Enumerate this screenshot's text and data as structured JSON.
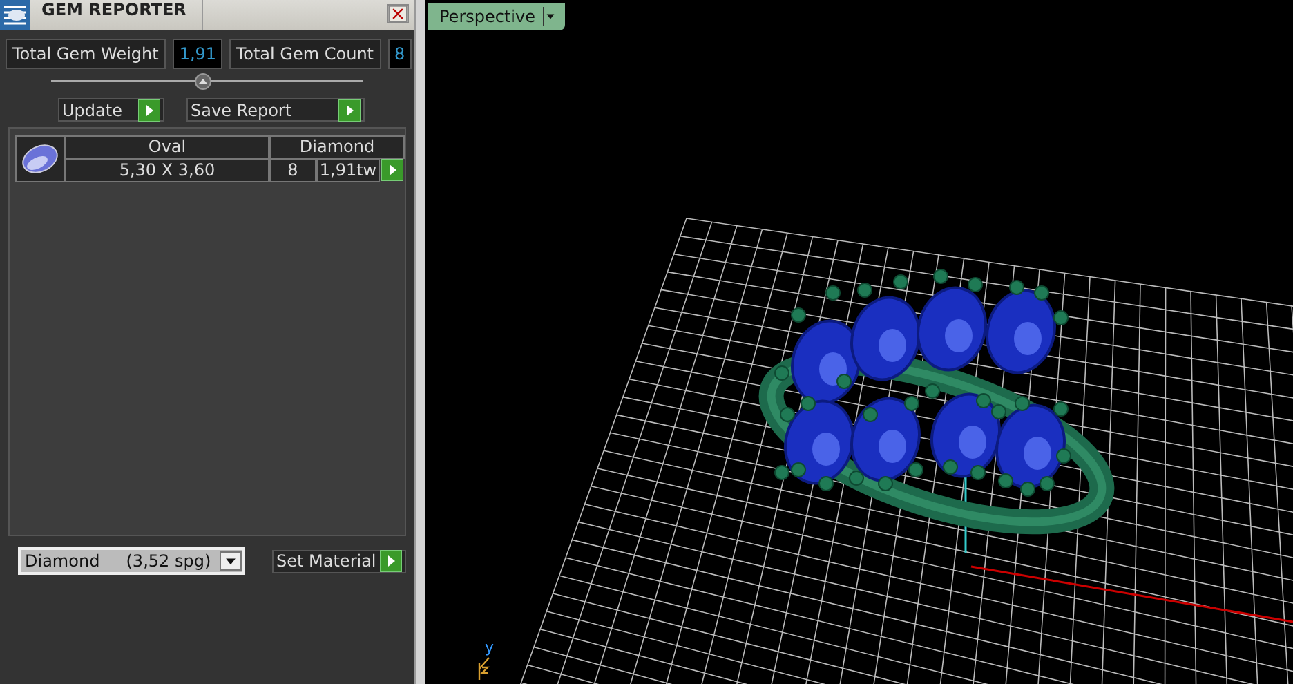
{
  "panel": {
    "title": "GEM REPORTER",
    "totals": [
      {
        "label": "Total Gem Weight",
        "value": "1,91"
      },
      {
        "label": "Total Gem Count",
        "value": "8"
      }
    ],
    "buttons": [
      "Update",
      "Save Report"
    ],
    "gems": [
      {
        "shape": "Oval",
        "material": "Diamond",
        "size": "5,30 X 3,60",
        "count": "8",
        "weight": "1,91tw"
      }
    ],
    "material_select": {
      "value": "Diamond     (3,52 spg)"
    },
    "set_button": "Set Material"
  },
  "viewport": {
    "view": "Perspective",
    "axis_label": "y"
  }
}
